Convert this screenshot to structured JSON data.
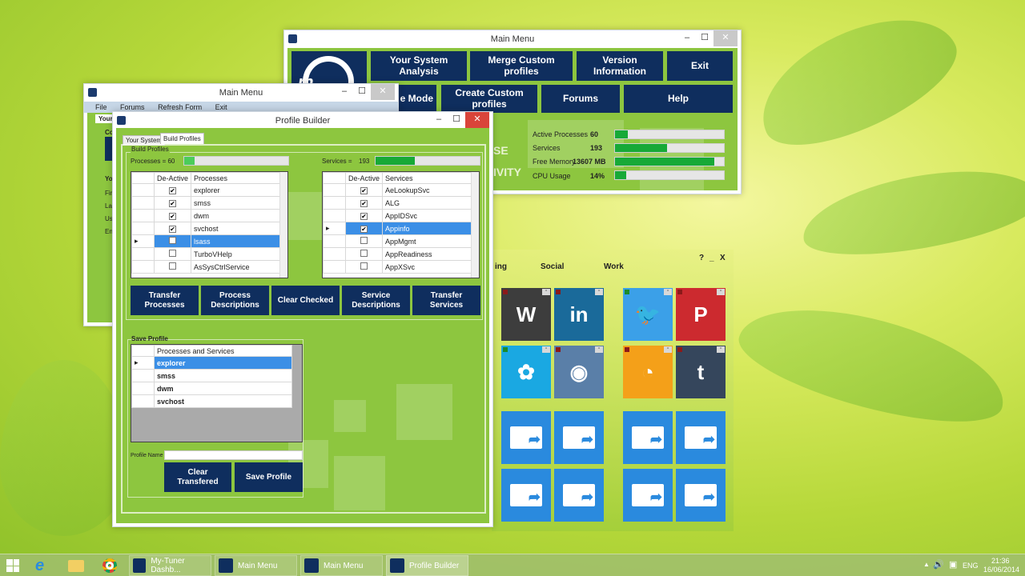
{
  "main_menu_front": {
    "title": "Main Menu",
    "buttons": {
      "system_analysis": "Your System Analysis",
      "merge_profiles": "Merge Custom profiles",
      "version_info": "Version Information",
      "exit": "Exit",
      "mode": "e Mode",
      "create_profiles": "Create Custom profiles",
      "forums": "Forums",
      "help": "Help"
    },
    "partial_text_1": "SE",
    "partial_text_2": "IVITY",
    "stats": [
      {
        "label": "Active Processes",
        "value": "60",
        "fill": 0.12
      },
      {
        "label": "Services",
        "value": "193",
        "fill": 0.48
      },
      {
        "label": "Free Memory",
        "value": "13607 MB",
        "fill": 0.91
      },
      {
        "label": "CPU Usage",
        "value": "14%",
        "fill": 0.1
      }
    ]
  },
  "main_menu_back": {
    "title": "Main Menu",
    "menu": [
      "File",
      "Forums",
      "Refresh Form",
      "Exit"
    ],
    "tab_partial": "Your",
    "group_partial": "Co",
    "section_partial": "Yo",
    "field_partials": [
      "Fir",
      "La",
      "Us",
      "En"
    ]
  },
  "profile_builder": {
    "title": "Profile Builder",
    "tabs": [
      "Your System",
      "Build Profiles"
    ],
    "active_tab": "Build Profiles",
    "group_title": "Build Profiles",
    "processes_label": "Processes = 60",
    "processes_fill": 0.1,
    "services_label": "Services =",
    "services_count": "193",
    "services_fill": 0.38,
    "processes_grid": {
      "headers": [
        "De-Active",
        "Processes"
      ],
      "rows": [
        {
          "checked": true,
          "name": "explorer"
        },
        {
          "checked": true,
          "name": "smss"
        },
        {
          "checked": true,
          "name": "dwm"
        },
        {
          "checked": true,
          "name": "svchost"
        },
        {
          "checked": false,
          "name": "lsass",
          "selected": true
        },
        {
          "checked": false,
          "name": "TurboVHelp"
        },
        {
          "checked": false,
          "name": "AsSysCtrlService"
        }
      ]
    },
    "services_grid": {
      "headers": [
        "De-Active",
        "Services"
      ],
      "rows": [
        {
          "checked": true,
          "name": "AeLookupSvc"
        },
        {
          "checked": true,
          "name": "ALG"
        },
        {
          "checked": true,
          "name": "AppIDSvc"
        },
        {
          "checked": true,
          "name": "Appinfo",
          "selected": true
        },
        {
          "checked": false,
          "name": "AppMgmt"
        },
        {
          "checked": false,
          "name": "AppReadiness"
        },
        {
          "checked": false,
          "name": "AppXSvc"
        }
      ]
    },
    "buttons": {
      "transfer_processes": "Transfer Processes",
      "process_descriptions": "Process Descriptions",
      "clear_checked": "Clear Checked",
      "service_descriptions": "Service Descriptions",
      "transfer_services": "Transfer Services",
      "clear_transfered": "Clear Transfered",
      "save_profile": "Save Profile"
    },
    "save_group_title": "Save Profile",
    "save_grid": {
      "header": "Processes and Services",
      "rows": [
        "explorer",
        "smss",
        "dwm",
        "svchost"
      ],
      "selected_index": 0
    },
    "profile_name_label": "Profile Name",
    "profile_name_value": ""
  },
  "dashboard": {
    "tabs_partial": [
      "ing",
      "Social",
      "Work"
    ],
    "controls": [
      "?",
      "_",
      "X"
    ],
    "tiles": [
      {
        "icon": "wordpress-icon",
        "glyph": "W",
        "color": "#3d3d3d",
        "tag": "#8b1a1a"
      },
      {
        "icon": "linkedin-icon",
        "glyph": "in",
        "color": "#1a6a9a",
        "tag": "#8b1a1a"
      },
      {
        "icon": "twitter-icon",
        "glyph": "🐦",
        "color": "#3ba0e8",
        "tag": "#1a8b2a"
      },
      {
        "icon": "pinterest-icon",
        "glyph": "P",
        "color": "#cc2a2f",
        "tag": "#8b1a1a"
      },
      {
        "icon": "msn-icon",
        "glyph": "✿",
        "color": "#1aa8e2",
        "tag": "#1a8b2a"
      },
      {
        "icon": "instagram-icon",
        "glyph": "◉",
        "color": "#5a7fa8",
        "tag": "#8b1a1a"
      },
      {
        "icon": "rss-icon",
        "glyph": "◔",
        "color": "#f4a019",
        "tag": "#8b1a1a"
      },
      {
        "icon": "tumblr-icon",
        "glyph": "t",
        "color": "#35465c",
        "tag": "#8b1a1a"
      }
    ],
    "folder_tile_count": 8
  },
  "taskbar": {
    "items": [
      "My-Tuner Dashb...",
      "Main Menu",
      "Main Menu",
      "Profile Builder"
    ],
    "language": "ENG",
    "time": "21:36",
    "date": "16/06/2014"
  }
}
